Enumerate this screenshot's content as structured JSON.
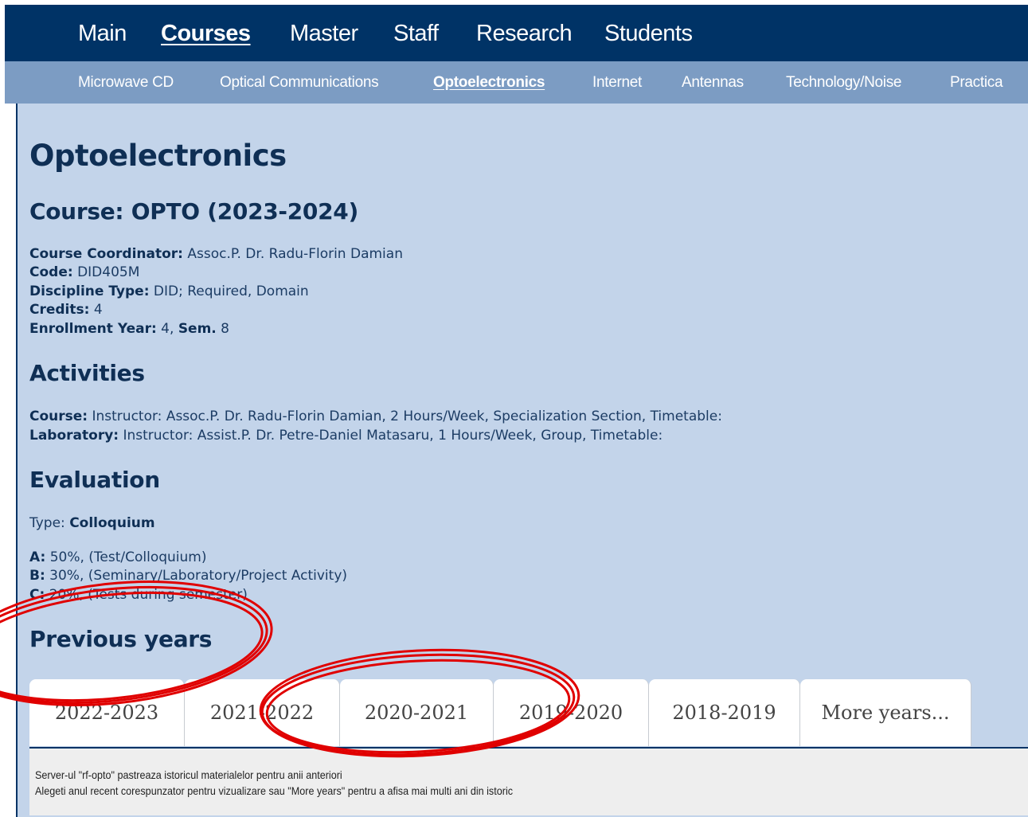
{
  "top_nav": {
    "items": [
      "Main",
      "Courses",
      "Master",
      "Staff",
      "Research",
      "Students"
    ],
    "active": "Courses"
  },
  "sub_nav": {
    "items": [
      "Microwave CD",
      "Optical Communications",
      "Optoelectronics",
      "Internet",
      "Antennas",
      "Technology/Noise",
      "Practica"
    ],
    "active": "Optoelectronics"
  },
  "page_title": "Optoelectronics",
  "course": {
    "heading": "Course: OPTO (2023-2024)",
    "coordinator_label": "Course Coordinator:",
    "coordinator": "Assoc.P. Dr. Radu-Florin Damian",
    "code_label": "Code:",
    "code": "DID405M",
    "discipline_label": "Discipline Type:",
    "discipline": "DID; Required, Domain",
    "credits_label": "Credits:",
    "credits": "4",
    "enrollment_label": "Enrollment Year:",
    "enrollment_year": "4,",
    "sem_label": "Sem.",
    "sem": "8"
  },
  "activities": {
    "heading": "Activities",
    "course_label": "Course:",
    "course_text": "Instructor: Assoc.P. Dr. Radu-Florin Damian, 2 Hours/Week, Specialization Section, Timetable:",
    "lab_label": "Laboratory:",
    "lab_text": "Instructor: Assist.P. Dr. Petre-Daniel Matasaru, 1 Hours/Week, Group, Timetable:"
  },
  "evaluation": {
    "heading": "Evaluation",
    "type_label": "Type:",
    "type": "Colloquium",
    "a_label": "A:",
    "a_text": "50%, (Test/Colloquium)",
    "b_label": "B:",
    "b_text": "30%, (Seminary/Laboratory/Project Activity)",
    "c_label": "C:",
    "c_text": "20%, (Tests during semester)"
  },
  "previous_years": {
    "heading": "Previous years",
    "tabs": [
      "2022-2023",
      "2021-2022",
      "2020-2021",
      "2019-2020",
      "2018-2019",
      "More years..."
    ],
    "note_line1": "Server-ul \"rf-opto\" pastreaza istoricul materialelor pentru anii anteriori",
    "note_line2": "Alegeti anul recent corespunzator pentru vizualizare sau \"More years\" pentru a afisa mai multi ani din istoric"
  },
  "colors": {
    "nav_dark": "#003366",
    "nav_light": "#7c9cc3",
    "content_bg": "#c3d4ea",
    "heading": "#0f2f55",
    "annotation": "#e00000"
  }
}
